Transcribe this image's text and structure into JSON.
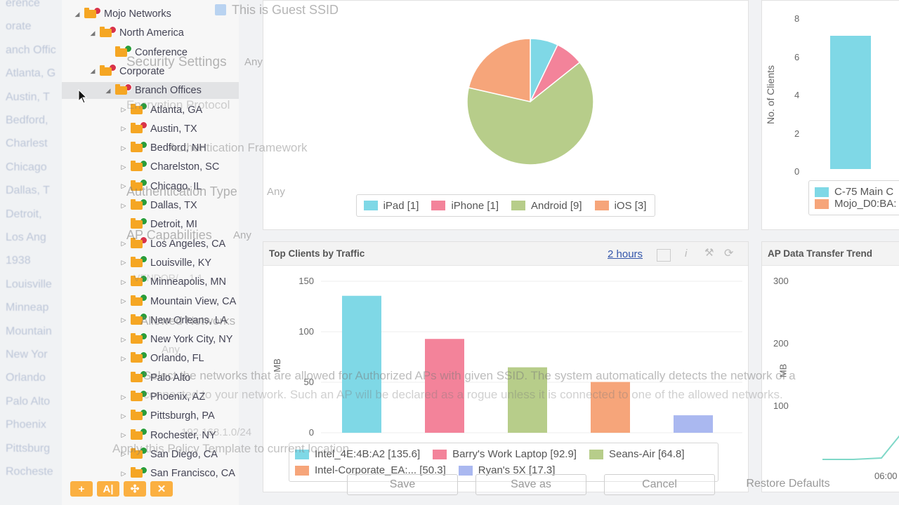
{
  "left_ghost": [
    "erence",
    "orate",
    "anch Offic",
    "Atlanta, G",
    "Austin, T",
    "Bedford,",
    "Charlest",
    "Chicago",
    "Dallas, T",
    "Detroit,",
    "Los Ang",
    "1938",
    "Louisville",
    "Minneap",
    "Mountain",
    "New Yor",
    "Orlando",
    "Palo Alto",
    "Phoenix",
    "Pittsburg",
    "Rocheste"
  ],
  "tree": {
    "nodes": [
      {
        "label": "Mojo Networks",
        "state": "er",
        "tw": "◢"
      },
      {
        "label": "North America",
        "state": "er",
        "tw": "◢"
      },
      {
        "label": "Conference",
        "state": "ok",
        "tw": ""
      },
      {
        "label": "Corporate",
        "state": "er",
        "tw": "◢"
      },
      {
        "label": "Branch Offices",
        "state": "er",
        "tw": "◢"
      },
      {
        "label": "Atlanta, GA",
        "state": "ok",
        "tw": "▷"
      },
      {
        "label": "Austin, TX",
        "state": "er",
        "tw": "▷"
      },
      {
        "label": "Bedford, NH",
        "state": "ok",
        "tw": "▷"
      },
      {
        "label": "Charelston, SC",
        "state": "ok",
        "tw": "▷"
      },
      {
        "label": "Chicago, IL",
        "state": "ok",
        "tw": "▷"
      },
      {
        "label": "Dallas, TX",
        "state": "ok",
        "tw": "▷"
      },
      {
        "label": "Detroit, MI",
        "state": "ok",
        "tw": ""
      },
      {
        "label": "Los Angeles, CA",
        "state": "er",
        "tw": "▷"
      },
      {
        "label": "Louisville, KY",
        "state": "ok",
        "tw": "▷"
      },
      {
        "label": "Minneapolis, MN",
        "state": "ok",
        "tw": "▷"
      },
      {
        "label": "Mountain View, CA",
        "state": "ok",
        "tw": "▷"
      },
      {
        "label": "New Orleans, LA",
        "state": "ok",
        "tw": "▷"
      },
      {
        "label": "New York City, NY",
        "state": "ok",
        "tw": "▷"
      },
      {
        "label": "Orlando, FL",
        "state": "ok",
        "tw": "▷"
      },
      {
        "label": "Palo Alto",
        "state": "ok",
        "tw": ""
      },
      {
        "label": "Phoenix, AZ",
        "state": "ok",
        "tw": "▷"
      },
      {
        "label": "Pittsburgh, PA",
        "state": "ok",
        "tw": "▷"
      },
      {
        "label": "Rochester, NY",
        "state": "ok",
        "tw": "▷"
      },
      {
        "label": "San Diego, CA",
        "state": "ok",
        "tw": "▷"
      },
      {
        "label": "San Francisco, CA",
        "state": "ok",
        "tw": "▷"
      }
    ],
    "toolbar": [
      "+",
      "A|",
      "✣",
      "✕"
    ]
  },
  "pie_card": {
    "legend": [
      {
        "label": "iPad [1]",
        "color": "#7fd8e6"
      },
      {
        "label": "iPhone [1]",
        "color": "#f3839a"
      },
      {
        "label": "Android [9]",
        "color": "#b7cd8a"
      },
      {
        "label": "iOS [3]",
        "color": "#f6a57a"
      }
    ]
  },
  "right_top_card": {
    "ylabel": "No. of Clients",
    "ticks": [
      "8",
      "6",
      "4",
      "2",
      "0"
    ],
    "legend": [
      "C-75 Main C",
      "Mojo_D0:BA:"
    ]
  },
  "traffic_card": {
    "title": "Top Clients by Traffic",
    "range_link": "2 hours",
    "ylabel": "MB",
    "ticks": [
      "150",
      "100",
      "50",
      "0"
    ],
    "legend": [
      {
        "label": "Intel_4E:4B:A2 [135.6]",
        "color": "#7fd8e6"
      },
      {
        "label": "Barry's Work Laptop [92.9]",
        "color": "#f3839a"
      },
      {
        "label": "Seans-Air [64.8]",
        "color": "#b7cd8a"
      },
      {
        "label": "Intel-Corporate_EA:... [50.3]",
        "color": "#f6a57a"
      },
      {
        "label": "Ryan's 5X [17.3]",
        "color": "#aab8f0"
      }
    ]
  },
  "ap_card": {
    "title": "AP Data Transfer Trend",
    "ylabel": "MB",
    "ticks": [
      "300",
      "200",
      "100"
    ],
    "xtick": "06:00"
  },
  "chart_data": [
    {
      "type": "pie",
      "categories": [
        "iPad",
        "iPhone",
        "Android",
        "iOS"
      ],
      "values": [
        1,
        1,
        9,
        3
      ]
    },
    {
      "type": "bar",
      "categories": [
        "Intel_4E:4B:A2",
        "Barry's Work Laptop",
        "Seans-Air",
        "Intel-Corporate_EA:...",
        "Ryan's 5X"
      ],
      "values": [
        135.6,
        92.9,
        64.8,
        50.3,
        17.3
      ],
      "title": "Top Clients by Traffic",
      "ylabel": "MB",
      "ylim": [
        0,
        150
      ]
    }
  ],
  "overlay": {
    "guest_ssid": "This is Guest SSID",
    "security_settings": "Security Settings",
    "any": "Any",
    "encryption": "Encryption Protocol",
    "auth_framework": "Authentication Framework",
    "auth_type": "Authentication Type",
    "ap_capabilities": "AP Capabilities",
    "vendor": "VENDOR/... 1 1",
    "allowed_networks": "Allowed Networks",
    "note_line1": "Select the networks that are allowed for Authorized APs with given SSID. The system automatically detects the network of a",
    "note_line2": "connected to your network. Such an AP will be declared as a rogue unless it is connected to one of the allowed networks.",
    "ip": "192.168.1.0/24",
    "apply": "Apply this Policy Template to current location",
    "save": "Save",
    "save_as": "Save as",
    "cancel": "Cancel",
    "restore": "Restore Defaults"
  }
}
